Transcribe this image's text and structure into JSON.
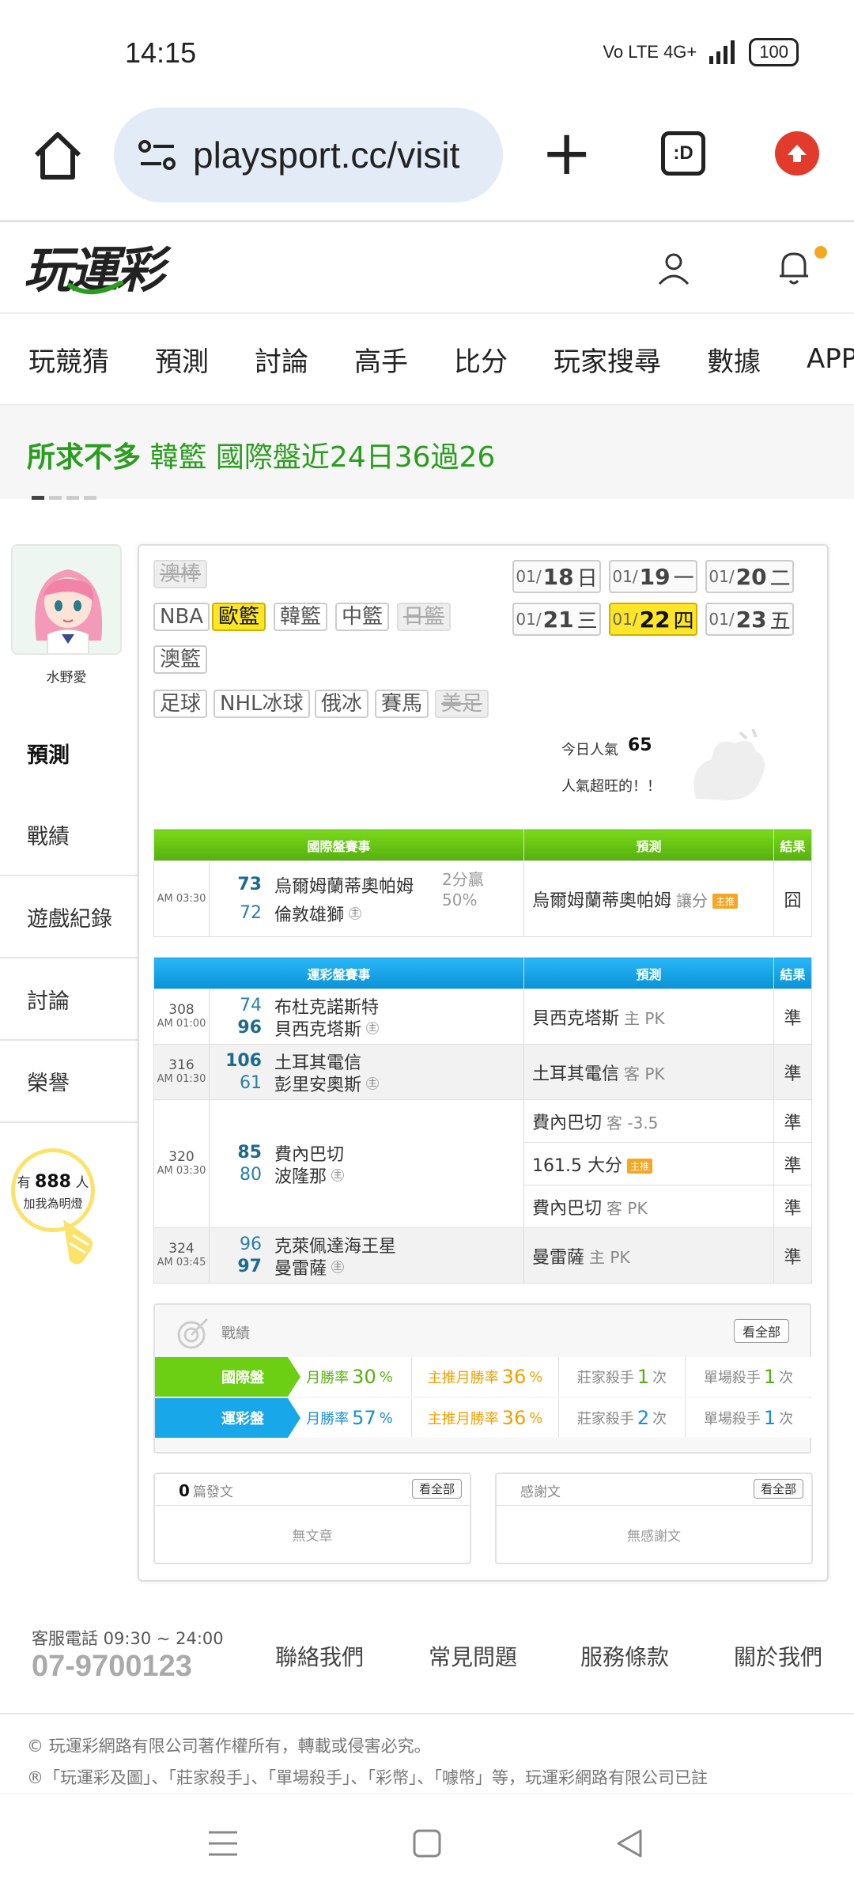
{
  "status_bar": {
    "time": "14:15",
    "network": "Vo LTE 4G+",
    "battery": "100"
  },
  "browser": {
    "url": "playsport.cc/visit",
    "tab_label": ":D"
  },
  "site": {
    "logo_text": "玩運彩"
  },
  "main_nav": [
    "玩競猜",
    "預測",
    "討論",
    "高手",
    "比分",
    "玩家搜尋",
    "數據",
    "APP"
  ],
  "marquee": {
    "highlight": "所求不多",
    "text": "韓籃 國際盤近24日36過26"
  },
  "profile": {
    "name": "水野愛"
  },
  "side_menu": [
    "預測",
    "戰績",
    "遊戲紀錄",
    "討論",
    "榮譽"
  ],
  "bulb": {
    "prefix": "有",
    "count": "888",
    "suffix": "人",
    "sub": "加我為明燈"
  },
  "league_tags": [
    {
      "label": "澳棒",
      "state": "disabled"
    },
    {
      "label": "NBA",
      "state": "normal"
    },
    {
      "label": "歐籃",
      "state": "active"
    },
    {
      "label": "韓籃",
      "state": "normal"
    },
    {
      "label": "中籃",
      "state": "normal"
    },
    {
      "label": "日籃",
      "state": "disabled"
    },
    {
      "label": "澳籃",
      "state": "normal"
    },
    {
      "label": "足球",
      "state": "normal"
    },
    {
      "label": "NHL冰球",
      "state": "normal"
    },
    {
      "label": "俄冰",
      "state": "normal"
    },
    {
      "label": "賽馬",
      "state": "normal"
    },
    {
      "label": "美足",
      "state": "disabled"
    }
  ],
  "dates": [
    {
      "month": "01/",
      "day": "18",
      "weekday": "日",
      "active": false
    },
    {
      "month": "01/",
      "day": "19",
      "weekday": "一",
      "active": false
    },
    {
      "month": "01/",
      "day": "20",
      "weekday": "二",
      "active": false
    },
    {
      "month": "01/",
      "day": "21",
      "weekday": "三",
      "active": false
    },
    {
      "month": "01/",
      "day": "22",
      "weekday": "四",
      "active": true
    },
    {
      "month": "01/",
      "day": "23",
      "weekday": "五",
      "active": false
    }
  ],
  "popularity": {
    "label": "今日人氣",
    "value": "65",
    "message": "人氣超旺的！！"
  },
  "intl_table": {
    "headers": [
      "國際盤賽事",
      "預測",
      "結果"
    ],
    "rows": [
      {
        "time": "AM 03:30",
        "score1": "73",
        "team1": "烏爾姆蘭蒂奧帕姆",
        "score2": "72",
        "team2": "倫敦雄獅",
        "home_mark": "主",
        "handicap": "2分贏",
        "handicap_pct": "50%",
        "pick": "烏爾姆蘭蒂奧帕姆",
        "pick_sub": "讓分",
        "badge": "主推",
        "result": "囧"
      }
    ]
  },
  "lottery_table": {
    "headers": [
      "運彩盤賽事",
      "預測",
      "結果"
    ],
    "rows": [
      {
        "num": "308",
        "time": "AM 01:00",
        "score1": "74",
        "team1": "布杜克諾斯特",
        "score2": "96",
        "team2": "貝西克塔斯",
        "home_mark": "主",
        "picks": [
          {
            "pick": "貝西克塔斯",
            "sub": "主 PK",
            "result": "準"
          }
        ]
      },
      {
        "num": "316",
        "time": "AM 01:30",
        "score1": "106",
        "team1": "土耳其電信",
        "score2": "61",
        "team2": "彭里安奧斯",
        "home_mark": "主",
        "picks": [
          {
            "pick": "土耳其電信",
            "sub": "客 PK",
            "result": "準"
          }
        ]
      },
      {
        "num": "320",
        "time": "AM 03:30",
        "score1": "85",
        "team1": "費內巴切",
        "score2": "80",
        "team2": "波隆那",
        "home_mark": "主",
        "picks": [
          {
            "pick": "費內巴切",
            "sub": "客 -3.5",
            "result": "準"
          },
          {
            "pick": "161.5 大分",
            "sub": "",
            "badge": "主推",
            "result": "準"
          },
          {
            "pick": "費內巴切",
            "sub": "客 PK",
            "result": "準"
          }
        ]
      },
      {
        "num": "324",
        "time": "AM 03:45",
        "score1": "96",
        "team1": "克萊佩達海王星",
        "score2": "97",
        "team2": "曼雷薩",
        "home_mark": "主",
        "picks": [
          {
            "pick": "曼雷薩",
            "sub": "主 PK",
            "result": "準"
          }
        ]
      }
    ]
  },
  "record": {
    "title": "戰績",
    "see_all": "看全部",
    "rows": [
      {
        "label": "國際盤",
        "month_rate_label": "月勝率",
        "month_rate": "30",
        "main_rate_label": "主推月勝率",
        "main_rate": "36",
        "killer_label": "莊家殺手",
        "killer": "1",
        "single_label": "單場殺手",
        "single": "1",
        "pct": "%",
        "unit": "次"
      },
      {
        "label": "運彩盤",
        "month_rate_label": "月勝率",
        "month_rate": "57",
        "main_rate_label": "主推月勝率",
        "main_rate": "36",
        "killer_label": "莊家殺手",
        "killer": "2",
        "single_label": "單場殺手",
        "single": "1",
        "pct": "%",
        "unit": "次"
      }
    ]
  },
  "posts": {
    "count": "0",
    "label": "篇發文",
    "see_all": "看全部",
    "empty": "無文章"
  },
  "thanks": {
    "label": "感謝文",
    "see_all": "看全部",
    "empty": "無感謝文"
  },
  "footer": {
    "phone_label": "客服電話 09:30 ~ 24:00",
    "phone": "07-9700123",
    "links": [
      "聯絡我們",
      "常見問題",
      "服務條款",
      "關於我們"
    ],
    "copyright": "© 玩運彩網路有限公司著作權所有，轉載或侵害必究。",
    "trademark": "®「玩運彩及圖」、「莊家殺手」、「單場殺手」、「彩幣」、「噱幣」等，玩運彩網路有限公司已註"
  },
  "colors": {
    "accent_green": "#2a9d1f",
    "table_green": "#6ccf14",
    "table_blue": "#18a7e8",
    "highlight_yellow": "#fde528",
    "upgrade_red": "#e23a2b"
  }
}
